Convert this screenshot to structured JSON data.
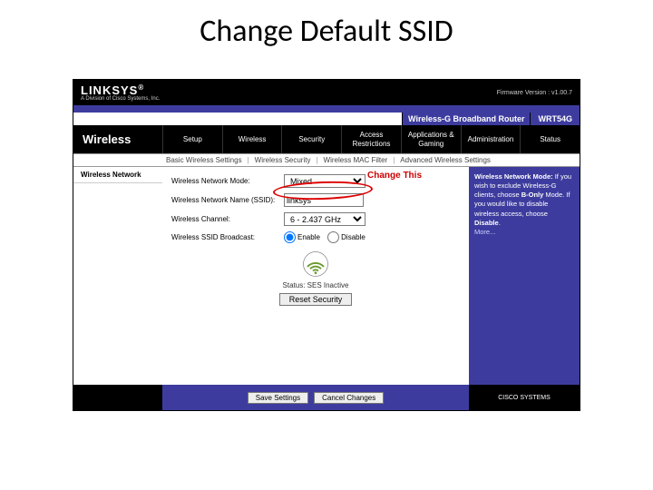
{
  "slide": {
    "title": "Change Default SSID"
  },
  "branding": {
    "brand": "LINKSYS",
    "tagline": "A Division of Cisco Systems, Inc.",
    "firmware": "Firmware Version : v1.00.7"
  },
  "header": {
    "product_title": "Wireless-G Broadband Router",
    "model": "WRT54G"
  },
  "page_name": "Wireless",
  "nav_tabs": [
    "Setup",
    "Wireless",
    "Security",
    "Access Restrictions",
    "Applications & Gaming",
    "Administration",
    "Status"
  ],
  "subnav": [
    "Basic Wireless Settings",
    "Wireless Security",
    "Wireless MAC Filter",
    "Advanced Wireless Settings"
  ],
  "section_label": "Wireless Network",
  "form": {
    "mode_label": "Wireless Network Mode:",
    "mode_value": "Mixed",
    "ssid_label": "Wireless Network Name (SSID):",
    "ssid_value": "linksys",
    "channel_label": "Wireless Channel:",
    "channel_value": "6 - 2.437 GHz",
    "broadcast_label": "Wireless SSID Broadcast:",
    "broadcast_enable": "Enable",
    "broadcast_disable": "Disable"
  },
  "annotation": {
    "change_this": "Change This"
  },
  "status_text": "Status: SES Inactive",
  "reset_button": "Reset Security",
  "footer": {
    "save": "Save Settings",
    "cancel": "Cancel Changes",
    "cisco": "CISCO SYSTEMS"
  },
  "help": {
    "heading": "Wireless Network Mode:",
    "body_1": "If you wish to exclude Wireless-G clients, choose ",
    "bold_1": "B-Only",
    "body_2": " Mode. If you would like to disable wireless access, choose ",
    "bold_2": "Disable",
    "more": "More..."
  }
}
